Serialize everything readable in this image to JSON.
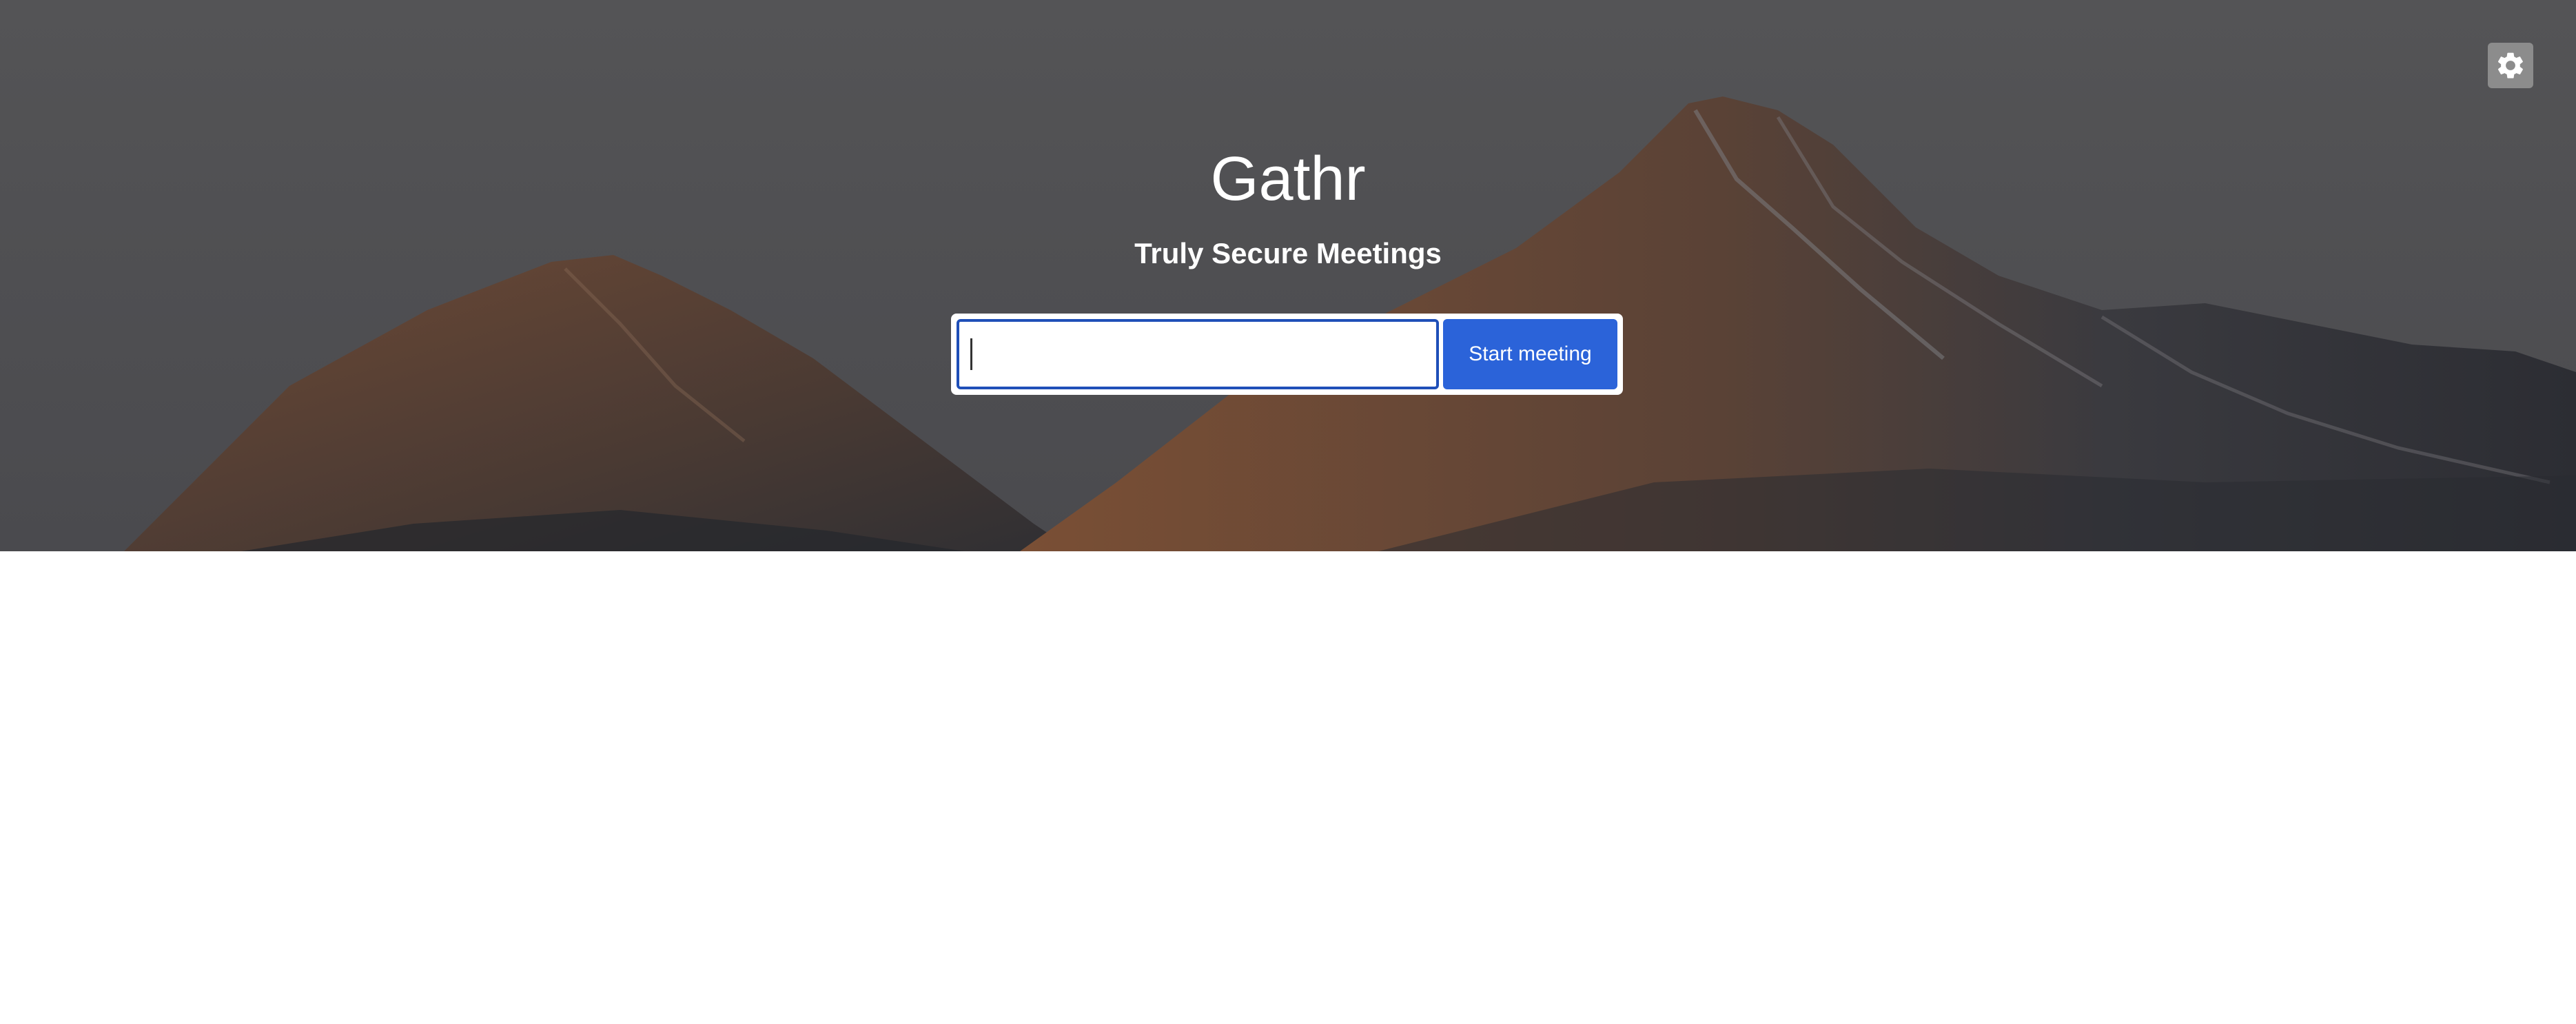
{
  "app": {
    "title": "Gathr",
    "tagline": "Truly Secure Meetings"
  },
  "meeting_form": {
    "input_value": "",
    "input_placeholder": "",
    "start_label": "Start meeting"
  },
  "settings": {
    "icon": "gear-icon"
  },
  "colors": {
    "primary_button": "#2b63d9",
    "input_focus_border": "#1f4fb8",
    "hero_overlay": "#4f4f52"
  }
}
